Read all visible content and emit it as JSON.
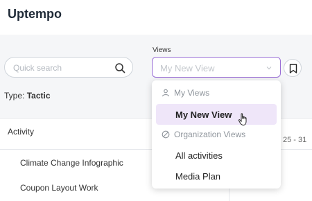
{
  "app": {
    "title": "Uptempo"
  },
  "search": {
    "placeholder": "Quick search"
  },
  "filter": {
    "label": "Type:",
    "value": "Tactic"
  },
  "views": {
    "label": "Views",
    "selected": "My New View",
    "dropdown": {
      "my_views_group": "My Views",
      "my_views_items": [
        "My New View"
      ],
      "org_views_group": "Organization Views",
      "org_views_items": [
        "All activities",
        "Media Plan"
      ]
    }
  },
  "table": {
    "activity_header": "Activity",
    "date_range": "25 - 31",
    "rows": [
      "Climate Change Infographic",
      "Coupon Layout Work"
    ]
  },
  "colors": {
    "accent": "#9a6fd6",
    "selected_bg": "#efe6f9"
  }
}
